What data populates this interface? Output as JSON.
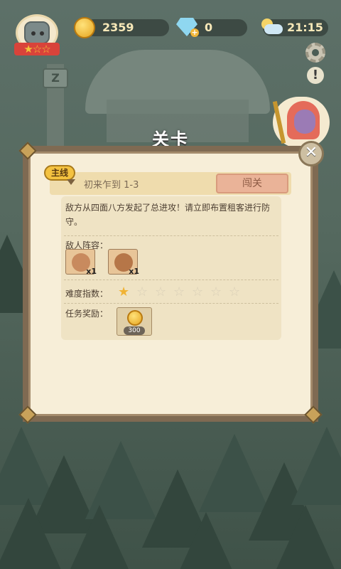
{
  "hud": {
    "player_stars": "★☆☆",
    "gold_amount": "2359",
    "gem_amount": "0",
    "plus_symbol": "+",
    "time": "21:15"
  },
  "icons": {
    "avatar": "rock-golem-avatar",
    "coin": "gold-coin-icon",
    "gem": "diamond-icon",
    "weather": "moon-cloud-icon",
    "settings": "gear-icon",
    "tips": "lightbulb-icon",
    "close": "close-icon"
  },
  "colors": {
    "panel_bg": "#f7eed8",
    "panel_border": "#7f6a52",
    "accent_gold": "#f0b335",
    "pass_button": "#eab398"
  },
  "sign_letter": "Z",
  "panel": {
    "title": "关卡",
    "close_symbol": "✕",
    "quest_tag": "主线",
    "quest_name": "初来乍到  1-3",
    "pass_button": "闯关",
    "description": "敌方从四面八方发起了总进攻！请立即布置租客进行防守。",
    "enemies_label": "敌人阵容：",
    "enemies": [
      {
        "count": "x1"
      },
      {
        "count": "x1"
      }
    ],
    "difficulty_label": "难度指数：",
    "difficulty": {
      "value": 1,
      "max": 7
    },
    "reward_label": "任务奖励：",
    "reward_amount": "300"
  }
}
